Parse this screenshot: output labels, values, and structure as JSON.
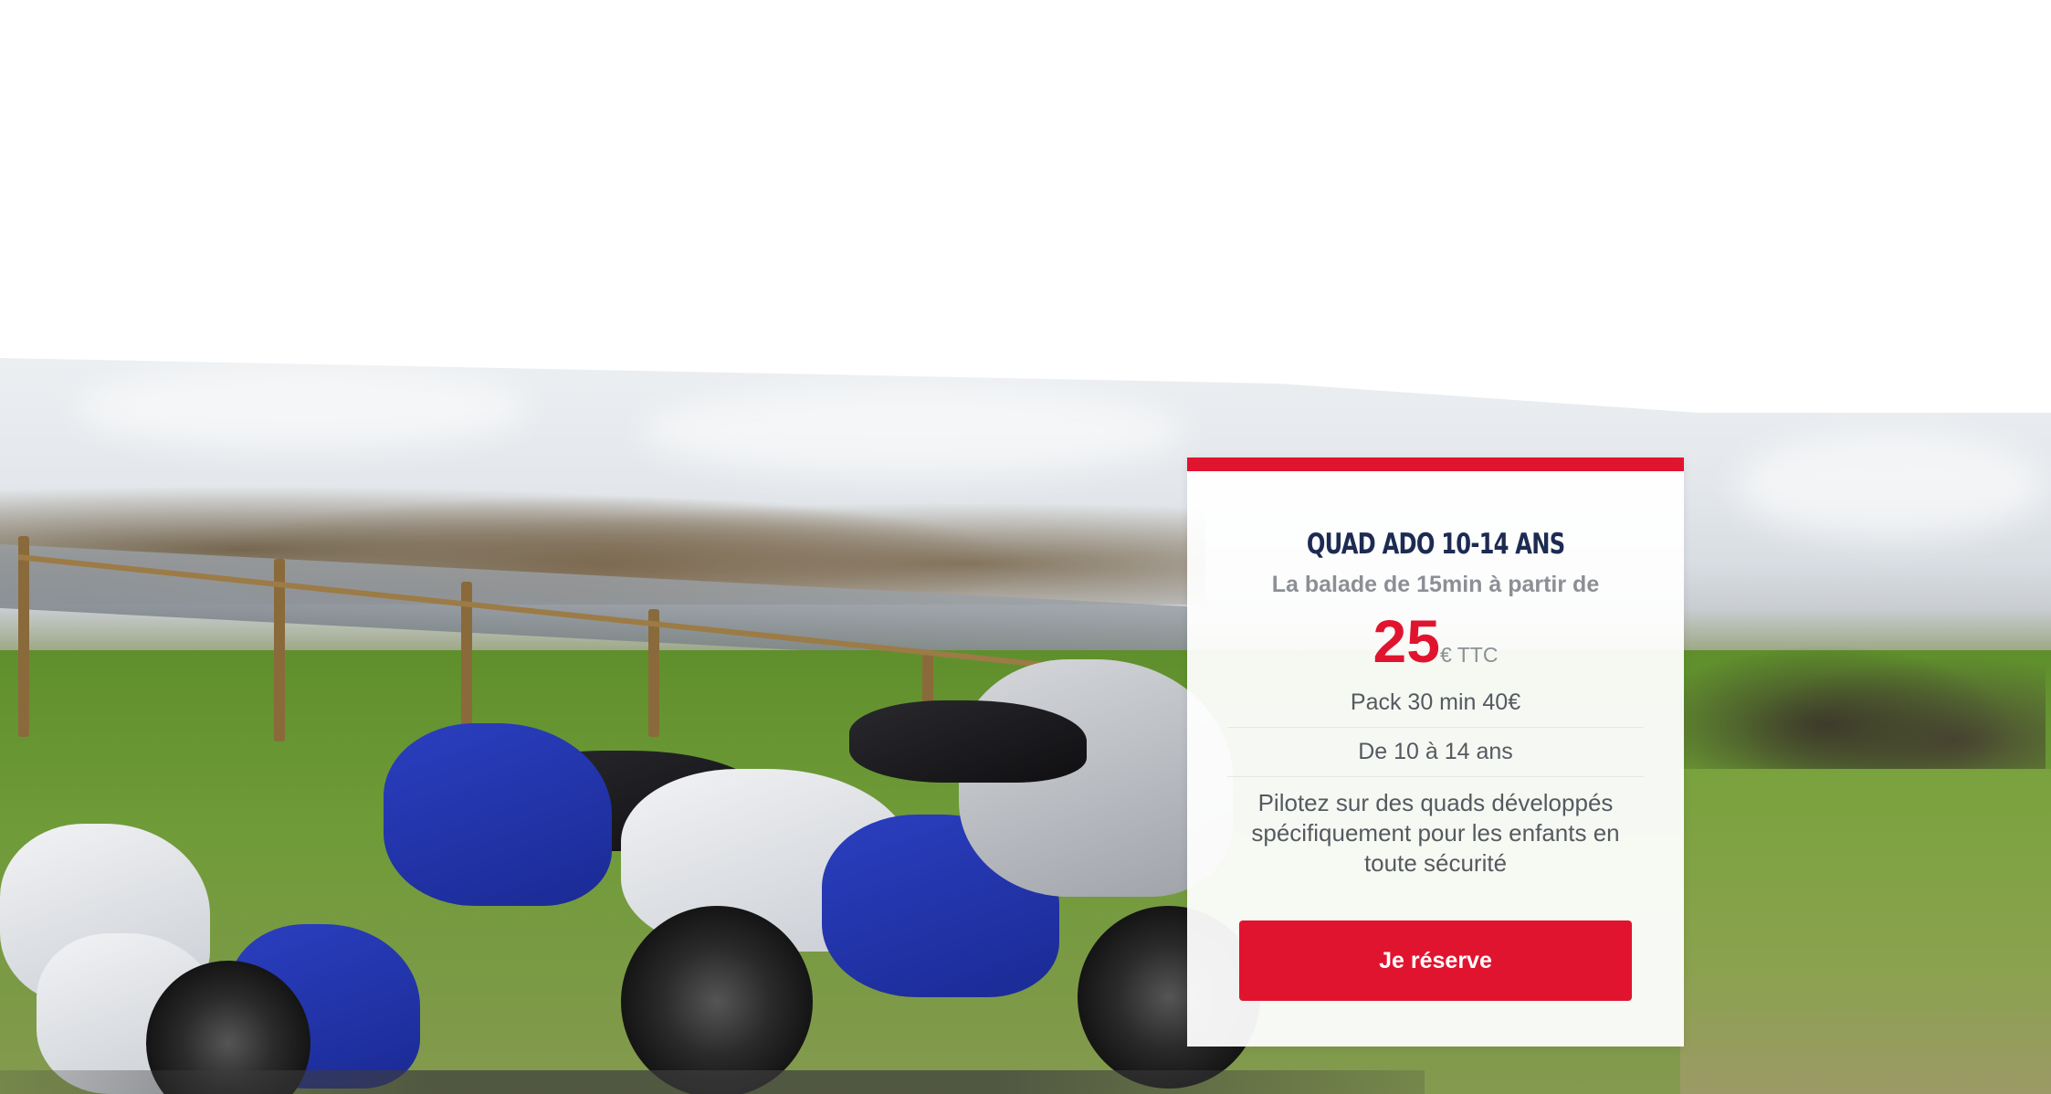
{
  "hero": {
    "image": "quad-bikes-photo"
  },
  "offer_card": {
    "title": "QUAD ADO 10-14 ANS",
    "subtitle": "La balade de 15min à partir de",
    "price": {
      "value": "25",
      "unit": "€ TTC"
    },
    "details": [
      "Pack 30 min 40€",
      "De 10 à 14 ans"
    ],
    "description": "Pilotez sur des quads développés spécifiquement pour les enfants en toute sécurité",
    "cta_label": "Je réserve"
  },
  "colors": {
    "accent": "#e1142f",
    "title": "#1d2b52",
    "muted": "#8c8f94",
    "body_text": "#555a60"
  }
}
